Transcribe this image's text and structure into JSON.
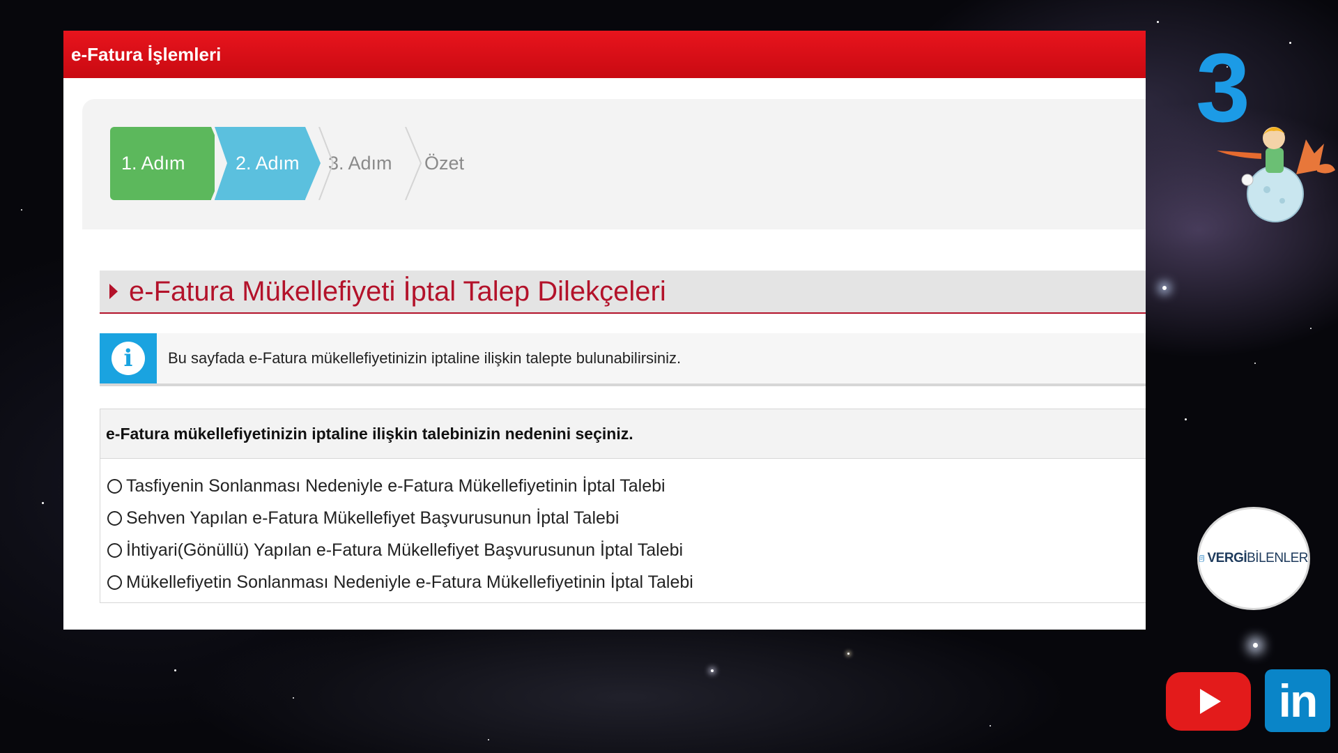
{
  "panel": {
    "header_title": "e-Fatura İşlemleri"
  },
  "wizard": {
    "steps": [
      {
        "label": "1. Adım",
        "state": "completed",
        "color": "#5cb85c"
      },
      {
        "label": "2. Adım",
        "state": "active",
        "color": "#5bc0de"
      },
      {
        "label": "3. Adım",
        "state": "pending"
      },
      {
        "label": "Özet",
        "state": "pending"
      }
    ]
  },
  "section": {
    "title": "e-Fatura Mükellefiyeti İptal Talep Dilekçeleri"
  },
  "info": {
    "icon": "info-icon",
    "text": "Bu sayfada e-Fatura mükellefiyetinizin iptaline ilişkin talepte bulunabilirsiniz."
  },
  "question": {
    "prompt": "e-Fatura mükellefiyetinizin iptaline ilişkin talebinizin nedenini seçiniz.",
    "options": [
      {
        "label": "Tasfiyenin Sonlanması Nedeniyle e-Fatura Mükellefiyetinin İptal Talebi",
        "selected": false
      },
      {
        "label": "Sehven Yapılan e-Fatura Mükellefiyet Başvurusunun İptal Talebi",
        "selected": false
      },
      {
        "label": "İhtiyari(Gönüllü) Yapılan e-Fatura Mükellefiyet Başvurusunun İptal Talebi",
        "selected": false
      },
      {
        "label": "Mükellefiyetin Sonlanması Nedeniyle e-Fatura Mükellefiyetinin İptal Talebi",
        "selected": false
      }
    ]
  },
  "overlay": {
    "step_number": "3",
    "brand_bold": "VERGİ",
    "brand_light": "BİLENLER",
    "social_icons": [
      "youtube-icon",
      "linkedin-icon"
    ],
    "linkedin_text": "in"
  },
  "colors": {
    "header_red": "#d4101a",
    "title_red": "#b3122a",
    "info_blue": "#1aa3e0",
    "step_green": "#5cb85c",
    "step_blue": "#5bc0de"
  }
}
